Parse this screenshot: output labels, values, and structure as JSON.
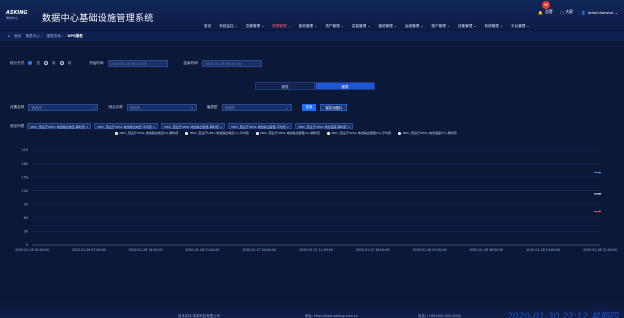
{
  "header": {
    "logo_text": "ASKING",
    "logo_sub": "数据中心",
    "app_title": "数据中心基础设施管理系统",
    "nav": [
      {
        "label": "首页",
        "active": false
      },
      {
        "label": "系统监控 ⌄",
        "active": false
      },
      {
        "label": "告警管理 ⌄",
        "active": false
      },
      {
        "label": "数据管理 ⌄",
        "active": true
      },
      {
        "label": "能效管理 ⌄",
        "active": false
      },
      {
        "label": "资产管理 ⌄",
        "active": false
      },
      {
        "label": "容量管理 ⌄",
        "active": false
      },
      {
        "label": "值班管理 ⌄",
        "active": false
      },
      {
        "label": "运维管理 ⌄",
        "active": false
      },
      {
        "label": "账户管理 ⌄",
        "active": false
      },
      {
        "label": "设备管理 ⌄",
        "active": false
      },
      {
        "label": "系统管理 ⌄",
        "active": false
      },
      {
        "label": "平台管理 ⌄",
        "active": false
      }
    ],
    "alarm_count": "99",
    "alarm_label": "告警",
    "fullscreen_label": "大屏",
    "user_label": "Administrator ⌄"
  },
  "breadcrumb": {
    "items": [
      "首页",
      "报表中心 ›",
      "报表查询 ›",
      "UPS报表"
    ]
  },
  "filters": {
    "stat_label": "统计方式",
    "radio_day": "日",
    "radio_month": "月",
    "radio_year": "月",
    "start_label": "开始时间",
    "start_value": "2020-01-26 00:21:04",
    "end_label": "结束时间",
    "end_value": "2020-01-26 00:21:04"
  },
  "tabs": [
    "报表",
    "报表"
  ],
  "filter2": {
    "device_label": "设备名称",
    "device_placeholder": "请选择",
    "point_label": "测点名称",
    "point_placeholder": "请选择",
    "type_label": "值类型",
    "type_placeholder": "请选择",
    "query_btn": "查询",
    "save_btn": "保存为图片"
  },
  "points": {
    "label": "测点列表",
    "chips": [
      "MDC_营业厅UPS1-电池输出电压-瞬时值 ×",
      "MDC_营业厅UPS1-电池输出电压-平均值 ×",
      "MDC_营业厅UPS1-电池输出容量-瞬时值 ×",
      "MDC_营业厅UPS1-电池输出容量-平均值 ×",
      "MDC_营业厅UPS1-电池温度-瞬时值 ×"
    ]
  },
  "legend": [
    "MDC_营业厅UPS1-电池输出电压(V)-瞬时值",
    "MDC_营业厅UPS1-电池输出电压(V)-平均值",
    "MDC_营业厅UPS1-电池输出容量(%)-瞬时值",
    "MDC_营业厅UPS1-电池输出容量(%)-平均值",
    "MDC_营业厅UPS1-电池温度(℃)-瞬时值"
  ],
  "chart_data": {
    "type": "line",
    "yticks": [
      "210",
      "180",
      "150",
      "120",
      "90",
      "60",
      "30",
      "0"
    ],
    "ylim": [
      0,
      210
    ],
    "x": [
      "2020-01-26 00:00:00",
      "2020-01-26 07:00:00",
      "2020-01-26 14:00:00",
      "2020-01-26 21:00:00",
      "2020-01-27 04:00:00",
      "2020-01-27 11:00:00",
      "2020-01-27 18:00:00",
      "2020-01-28 01:00:00",
      "2020-01-28 08:00:00",
      "2020-01-28 15:00:00",
      "2020-01-28 22:00:00"
    ],
    "series": [
      {
        "color": "#4aa3ff",
        "values": [
          null,
          null,
          null,
          null,
          null,
          null,
          null,
          null,
          null,
          null,
          160
        ]
      },
      {
        "color": "#ffffff",
        "values": [
          null,
          null,
          null,
          null,
          null,
          null,
          null,
          null,
          null,
          null,
          113
        ]
      },
      {
        "color": "#ff5b6b",
        "values": [
          null,
          null,
          null,
          null,
          null,
          null,
          null,
          null,
          null,
          null,
          74
        ]
      }
    ]
  },
  "footer": {
    "company": "技术支持:某某科技有限公司",
    "site": "网址: http://www.asking.com.cn",
    "phone": "电话: (+86)400-000-0000",
    "clock": "2020-01-30 22:12 星期四"
  }
}
